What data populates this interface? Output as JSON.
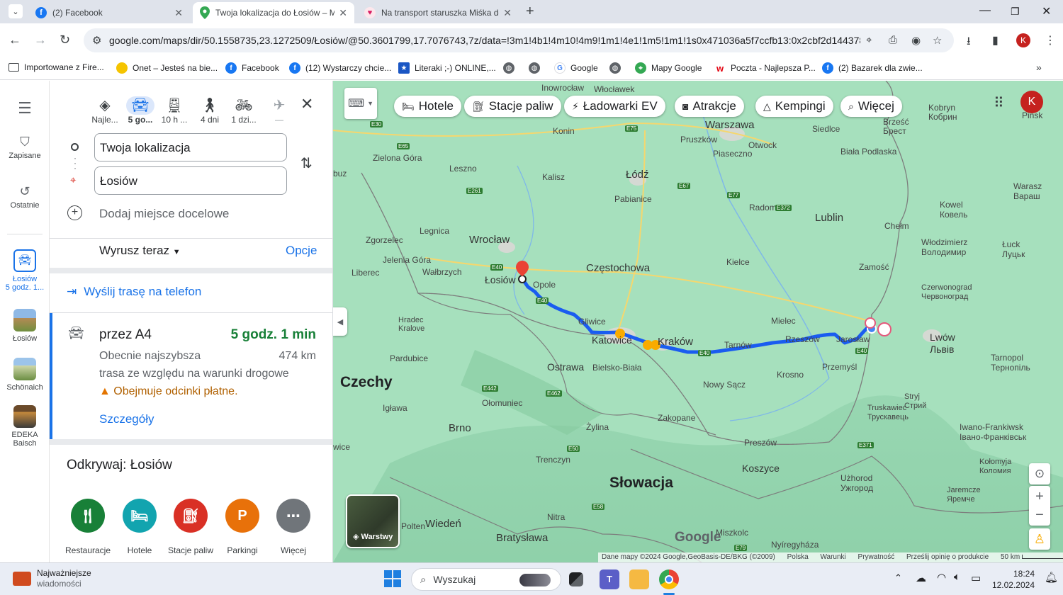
{
  "browser": {
    "tabs": [
      {
        "title": "(2) Facebook",
        "icon": "facebook-icon",
        "active": false
      },
      {
        "title": "Twoja lokalizacja do Łosiów – Mapy Google",
        "icon": "maps-pin-icon",
        "active": true
      },
      {
        "title": "Na transport staruszka Miśka do",
        "icon": "heart-icon",
        "active": false
      }
    ],
    "url": "google.com/maps/dir/50.1558735,23.1272509/Łosiów/@50.3601799,17.7076743,7z/data=!3m1!4b1!4m10!4m9!1m1!4e1!1m5!1m1!1s0x471036a5f7ccfb13:0x2cbf2d14437895d...",
    "profile_letter": "K",
    "bookmarks": [
      {
        "label": "Importowane z Fire...",
        "icon": "folder-icon"
      },
      {
        "label": "Onet – Jesteś na bie...",
        "icon": "onet-icon"
      },
      {
        "label": "Facebook",
        "icon": "facebook-icon"
      },
      {
        "label": "(12) Wystarczy chcie...",
        "icon": "facebook-icon"
      },
      {
        "label": "Literaki ;-) ONLINE,...",
        "icon": "star-icon"
      },
      {
        "label": "",
        "icon": "globe-icon"
      },
      {
        "label": "",
        "icon": "globe-icon"
      },
      {
        "label": "Google",
        "icon": "google-icon"
      },
      {
        "label": "",
        "icon": "globe-icon"
      },
      {
        "label": "Mapy Google",
        "icon": "maps-pin-icon"
      },
      {
        "label": "Poczta - Najlepsza P...",
        "icon": "wp-icon"
      },
      {
        "label": "(2) Bazarek dla zwie...",
        "icon": "facebook-icon"
      }
    ]
  },
  "rail": {
    "saved": "Zapisane",
    "recent": "Ostatnie",
    "items": [
      {
        "label1": "Łosiów",
        "label2": "5 godz. 1..."
      },
      {
        "label1": "Łosiów",
        "label2": ""
      },
      {
        "label1": "Schönaich",
        "label2": ""
      },
      {
        "label1": "EDEKA",
        "label2": "Baisch"
      }
    ]
  },
  "directions": {
    "modes": [
      {
        "label": "Najle...",
        "icon": "best-route-icon"
      },
      {
        "label": "5 go...",
        "icon": "car-icon"
      },
      {
        "label": "10 h ...",
        "icon": "train-icon"
      },
      {
        "label": "4 dni",
        "icon": "walk-icon"
      },
      {
        "label": "1 dzi...",
        "icon": "bike-icon"
      },
      {
        "label": "—",
        "icon": "plane-icon"
      }
    ],
    "origin": "Twoja lokalizacja",
    "destination": "Łosiów",
    "add_destination": "Dodaj miejsce docelowe",
    "depart": "Wyrusz teraz",
    "options": "Opcje",
    "send_to_phone": "Wyślij trasę na telefon",
    "route": {
      "via": "przez A4",
      "duration": "5 godz. 1 min",
      "desc1": "Obecnie najszybsza",
      "distance": "474 km",
      "desc2": "trasa ze względu na warunki drogowe",
      "warning": "Obejmuje odcinki płatne.",
      "details": "Szczegóły"
    },
    "explore_title": "Odkrywaj: Łosiów",
    "categories": [
      {
        "label": "Restauracje",
        "color": "#188038",
        "icon": "fork-knife-icon"
      },
      {
        "label": "Hotele",
        "color": "#12a4af",
        "icon": "bed-icon"
      },
      {
        "label": "Stacje paliw",
        "color": "#d93025",
        "icon": "fuel-icon"
      },
      {
        "label": "Parkingi",
        "color": "#e8710a",
        "icon": "parking-icon"
      },
      {
        "label": "Więcej",
        "color": "#5f6368",
        "icon": "more-icon"
      }
    ]
  },
  "map": {
    "chips": [
      {
        "label": "Hotele",
        "icon": "bed-icon"
      },
      {
        "label": "Stacje paliw",
        "icon": "fuel-icon"
      },
      {
        "label": "Ładowarki EV",
        "icon": "ev-charger-icon"
      },
      {
        "label": "Atrakcje",
        "icon": "camera-icon"
      },
      {
        "label": "Kempingi",
        "icon": "tent-icon"
      },
      {
        "label": "Więcej",
        "icon": "search-icon"
      }
    ],
    "labels": {
      "warszawa": "Warszawa",
      "lodz": "Łódź",
      "wroclaw": "Wrocław",
      "losiow": "Łosiów",
      "opole": "Opole",
      "czestochowa": "Częstochowa",
      "katowice": "Katowice",
      "krakow": "Kraków",
      "tarnow": "Tarnów",
      "rzeszow": "Rzeszów",
      "jaroslaw": "Jarosław",
      "przemysl": "Przemyśl",
      "lublin": "Lublin",
      "radom": "Radom",
      "kielce": "Kielce",
      "zamosc": "Zamość",
      "chelm": "Chełm",
      "mielec": "Mielec",
      "krosno": "Krosno",
      "nowy_sacz": "Nowy Sącz",
      "gliwice": "Gliwice",
      "ostrawa": "Ostrawa",
      "bielsko": "Bielsko-Biała",
      "zakopane": "Zakopane",
      "czechy": "Czechy",
      "slowacja": "Słowacja",
      "brno": "Brno",
      "olomuniec": "Ołomuniec",
      "wieden": "Wiedeń",
      "bratyslawa": "Bratysława",
      "koszyce": "Koszyce",
      "preszow": "Preszów",
      "lwow": "Lwów",
      "lwow_uk": "Львів",
      "tarnopol": "Tarnopol",
      "tarnopol_uk": "Тернопіль",
      "luck": "Łuck",
      "luck_uk": "Луцьк",
      "kowel": "Kowel",
      "kowel_uk": "Ковель",
      "wlodzimierz": "Włodzimierz",
      "wlodzimierz_uk": "Володимир",
      "brzesc": "Brześć",
      "brzesc_uk": "Брест",
      "kobryn": "Kobryn",
      "kobryn_uk": "Кобрин",
      "pinsk": "Pińsk",
      "siedlce": "Siedlce",
      "biala": "Biała Podlaska",
      "pruszkow": "Pruszków",
      "piaseczno": "Piaseczno",
      "otwock": "Otwock",
      "konin": "Konin",
      "kalisz": "Kalisz",
      "pabianice": "Pabianice",
      "leszno": "Leszno",
      "legnica": "Legnica",
      "zielona": "Zielona Góra",
      "jelenia": "Jelenia Góra",
      "walbrzych": "Wałbrzych",
      "liberec": "Liberec",
      "hradec": "Hradec Kralove",
      "pardubice": "Pardubice",
      "jihlava": "Igława",
      "zylina": "Żylina",
      "trenczyn": "Trenczyn",
      "nitra": "Nitra",
      "uzhorod": "Użhorod",
      "uzhorod_uk": "Ужгород",
      "truskawiec": "Truskawiec",
      "truskawiec_uk": "Трускавець",
      "stryj": "Stryj",
      "stryj_uk": "Стрий",
      "iwano": "Iwano-Frankiwsk",
      "iwano_uk": "Івано-Франківськ",
      "kolomyja": "Kołomyja",
      "kolomyja_uk": "Коломия",
      "jaremcze": "Jaremcze",
      "jaremcze_uk": "Яремче",
      "miszkolc": "Miszkolc",
      "nyiregyhaza": "Nyíregyháza",
      "inowroclaw": "Inowrocław",
      "wloclawek": "Włocławek",
      "czerwonograd": "Czerwonograd",
      "czerwonograd_uk": "Червоноград",
      "warasz": "Warasz",
      "warasz_uk": "Вараш",
      "zgorzelec": "Zgorzelec",
      "polten": "Polten",
      "wice": "wice",
      "buz": "buz"
    },
    "road_labels": [
      "E30",
      "E65",
      "E75",
      "E67",
      "E77",
      "E372",
      "E261",
      "E40",
      "E462",
      "E442",
      "E50",
      "E58",
      "E79",
      "E371"
    ],
    "layers": "Warstwy",
    "attribution": {
      "data": "Dane mapy ©2024 Google,GeoBasis-DE/BKG (©2009)",
      "country": "Polska",
      "terms": "Warunki",
      "privacy": "Prywatność",
      "feedback": "Prześlij opinię o produkcie",
      "scale": "50 km"
    },
    "google_logo": "Google",
    "route_color": "#1a5cf0",
    "water_color": "#9fdcb6"
  },
  "taskbar": {
    "news_title": "Najważniejsze",
    "news_sub": "wiadomości",
    "search": "Wyszukaj",
    "time": "18:24",
    "date": "12.02.2024"
  }
}
